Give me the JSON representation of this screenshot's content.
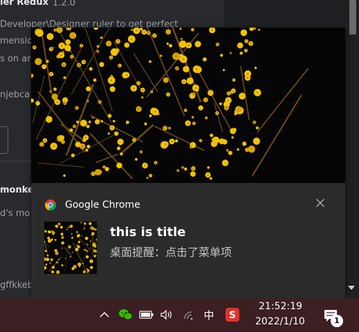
{
  "background": {
    "ext1_name": "ler Redux",
    "ext1_version": "1.2.0",
    "ext1_desc_line1": "Developer\\Designer ruler to get perfect",
    "ext1_desc_line2": "mensio",
    "ext1_desc_line3": "s on ar",
    "ext1_id": "njebca",
    "ext2_name": "monke",
    "ext2_desc": "d's mo",
    "ext2_id": "gffkkebhfmkfjojejmpbldmpobfkfo"
  },
  "notification": {
    "app_name": "Google Chrome",
    "title": "this is title",
    "body": "桌面提醒：点击了菜单项",
    "app_icon": "chrome-icon",
    "close_icon": "close-icon"
  },
  "taskbar": {
    "time": "21:52:19",
    "date": "2022/1/10",
    "ime": "中",
    "notification_count": "1",
    "icons": [
      "chevron-up-icon",
      "wechat-icon",
      "battery-icon",
      "speaker-icon",
      "wifi-icon",
      "sogou-icon",
      "action-center-icon"
    ]
  },
  "colors": {
    "taskbar_bg": "#3b1f23",
    "toast_bg": "#2b2b2b",
    "flower_yellow": "#f2c200"
  }
}
